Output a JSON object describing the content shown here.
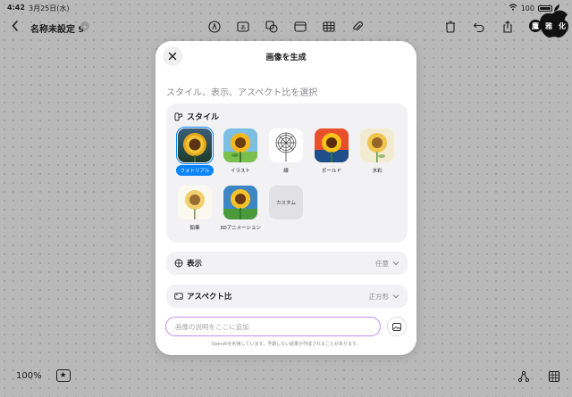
{
  "statusbar": {
    "time": "4:42",
    "date": "3月25日(水)",
    "battery": "100"
  },
  "toolbar": {
    "title": "名称未設定 9"
  },
  "badge": {
    "char1": "鷹",
    "char2": "雅",
    "char3": "化"
  },
  "bottom": {
    "zoom": "100%"
  },
  "modal": {
    "title": "画像を生成",
    "subtitle": "スタイル、表示、アスペクト比を選択",
    "style_section": "スタイル",
    "styles": [
      {
        "label": "フォトリアル",
        "selected": true
      },
      {
        "label": "イラスト"
      },
      {
        "label": "線"
      },
      {
        "label": "ボールド"
      },
      {
        "label": "水彩"
      },
      {
        "label": "鉛筆"
      },
      {
        "label": "3Dアニメーション"
      },
      {
        "label": "カスタム"
      }
    ],
    "display": {
      "label": "表示",
      "value": "任意"
    },
    "aspect": {
      "label": "アスペクト比",
      "value": "正方形"
    },
    "prompt_placeholder": "画像の説明をここに追加",
    "footnote": "OpenAIを利用しています。予期しない結果が作成されることがあります。"
  }
}
